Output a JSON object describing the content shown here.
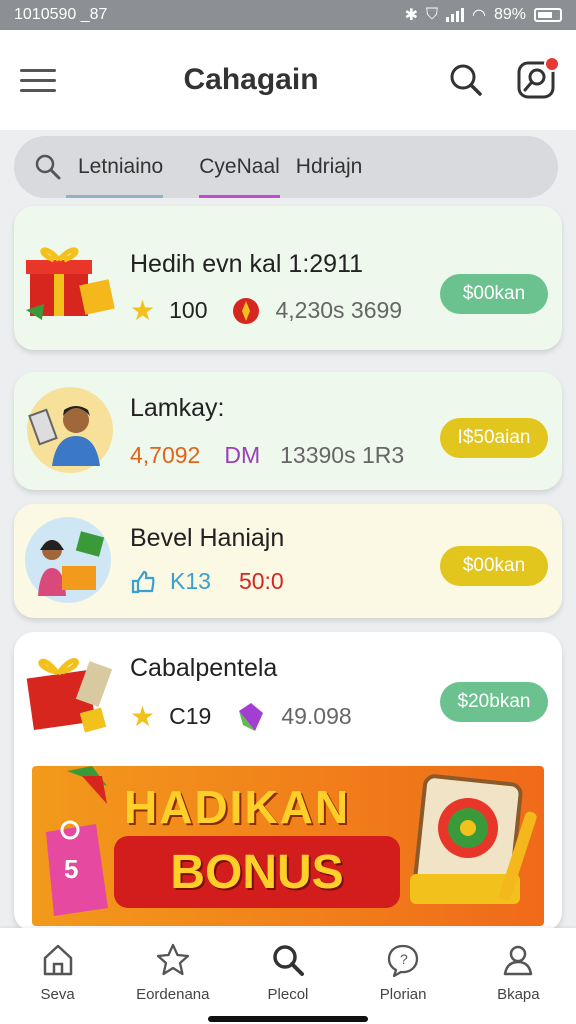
{
  "status_bar": {
    "time": "1010590 _87",
    "battery": "89%"
  },
  "header": {
    "title": "Cahagain"
  },
  "tabs": [
    {
      "label": "Letniaino"
    },
    {
      "label": "CyeNaal"
    },
    {
      "label": "Hdriajn"
    }
  ],
  "cards": [
    {
      "title": "Hedih evn kal 1:2911",
      "stat1": "100",
      "stat2": "4,230s 3699",
      "action": "$00kan",
      "bg": "#eef8ec",
      "pill_color": "#6cc28e"
    },
    {
      "title": "Lamkay:",
      "stat1": "4,7092",
      "stat2_icon": "DM",
      "stat2": "13390s 1R3",
      "action": "I$50aian",
      "bg": "#eef8ec",
      "pill_color": "#e2c51d"
    },
    {
      "title": "Bevel Haniajn",
      "stat1": "K13",
      "stat2": "50:0",
      "action": "$00kan",
      "bg": "#fbf8e4",
      "pill_color": "#e2c51d"
    },
    {
      "title": "Cabalpentela",
      "stat1": "C19",
      "stat2": "49.098",
      "action": "$20bkan",
      "bg": "#ffffff",
      "pill_color": "#6cc28e"
    }
  ],
  "banner": {
    "line1": "HADIKAN",
    "line2": "BONUS"
  },
  "bottom_nav": [
    {
      "label": "Seva",
      "icon": "home-icon"
    },
    {
      "label": "Eordenana",
      "icon": "star-icon"
    },
    {
      "label": "Plecol",
      "icon": "search-icon"
    },
    {
      "label": "Plorian",
      "icon": "chat-icon"
    },
    {
      "label": "Bkapa",
      "icon": "profile-icon"
    }
  ]
}
